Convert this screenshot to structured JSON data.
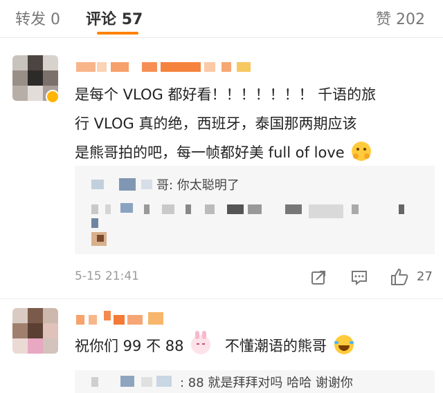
{
  "tabs": [
    {
      "label": "转发",
      "count": "0"
    },
    {
      "label": "评论",
      "count": "57"
    },
    {
      "label": "赞",
      "count": "202"
    }
  ],
  "comments": [
    {
      "text_line1": "是每个 VLOG 都好看！！！！！！！ 千语的旅",
      "text_line2": "行 VLOG 真的绝，西班牙，泰国那两期应该",
      "text_line3": "是熊哥拍的吧，每一帧都好美 full of love",
      "emoji": "hug-emoji",
      "reply_visible_suffix": "哥: 你太聪明了",
      "timestamp": "5-15 21:41",
      "likes": "27"
    },
    {
      "text_part1": "祝你们 99 不 88",
      "emoji1": "bunny-emoji",
      "text_part2": "不懂潮语的熊哥",
      "emoji2": "laugh-cry-emoji",
      "reply_visible_suffix": ": 88 就是拜拜对吗  哈哈 谢谢你"
    }
  ],
  "colors": {
    "accent": "#ff8200",
    "muted": "#9a9a9a",
    "reply_bg": "#f6f6f6"
  }
}
